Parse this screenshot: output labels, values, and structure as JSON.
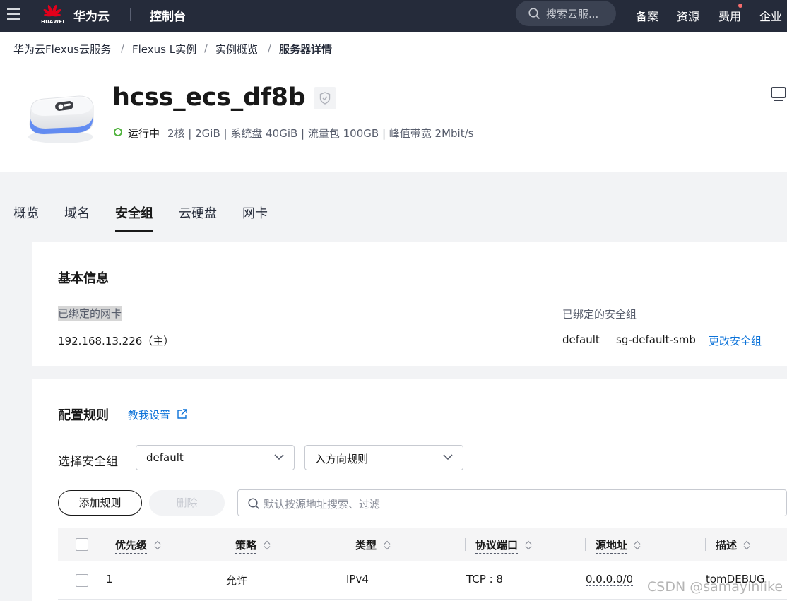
{
  "topbar": {
    "logo_text": "HUAWEI",
    "brand": "华为云",
    "console": "控制台",
    "search_placeholder": "搜索云服...",
    "links": [
      "备案",
      "资源",
      "费用",
      "企业"
    ]
  },
  "breadcrumb": [
    "华为云Flexus云服务",
    "Flexus L实例",
    "实例概览",
    "服务器详情"
  ],
  "breadcrumb_sep": "/",
  "header": {
    "title": "hcss_ecs_df8b",
    "status": "运行中",
    "specs": "2核 | 2GiB | 系统盘 40GiB | 流量包 100GB | 峰值带宽 2Mbit/s"
  },
  "tabs": [
    "概览",
    "域名",
    "安全组",
    "云硬盘",
    "网卡"
  ],
  "active_tab": "安全组",
  "basic_info": {
    "heading": "基本信息",
    "nic_label": "已绑定的网卡",
    "nic_value": "192.168.13.226（主）",
    "sg_label": "已绑定的安全组",
    "sg_values": [
      "default",
      "sg-default-smb"
    ],
    "change_link": "更改安全组"
  },
  "rules": {
    "heading": "配置规则",
    "tutorial_link": "教我设置",
    "select_label": "选择安全组",
    "select_sg_value": "default",
    "select_direction_value": "入方向规则",
    "add_button": "添加规则",
    "delete_button": "删除",
    "search_placeholder": "默认按源地址搜索、过滤",
    "columns": [
      "优先级",
      "策略",
      "类型",
      "协议端口",
      "源地址",
      "描述"
    ],
    "rows": [
      {
        "priority": "1",
        "policy": "允许",
        "type": "IPv4",
        "port": "TCP : 8",
        "source": "0.0.0.0/0",
        "desc": "tomDEBUG"
      }
    ]
  },
  "watermark": "CSDN @samayinlike",
  "colors": {
    "topbar": "#252b3a",
    "link": "#0d73d9",
    "status_green": "#50b33d"
  }
}
